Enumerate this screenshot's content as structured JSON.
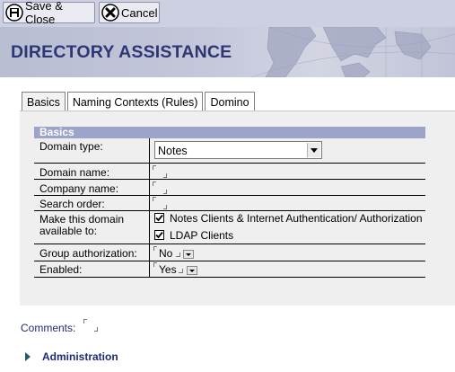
{
  "toolbar": {
    "save_label": "Save & Close",
    "save_icon": "disk-icon",
    "cancel_label": "Cancel",
    "cancel_icon": "close-circle-icon"
  },
  "banner": {
    "title": "DIRECTORY ASSISTANCE"
  },
  "tabs": [
    {
      "label": "Basics",
      "active": true
    },
    {
      "label": "Naming Contexts (Rules)",
      "active": false
    },
    {
      "label": "Domino",
      "active": false
    }
  ],
  "section": {
    "title": "Basics",
    "fields": {
      "domain_type": {
        "label": "Domain type:",
        "value": "Notes"
      },
      "domain_name": {
        "label": "Domain name:",
        "value": ""
      },
      "company_name": {
        "label": "Company name:",
        "value": ""
      },
      "search_order": {
        "label": "Search order:",
        "value": ""
      },
      "make_available": {
        "label_line1": "Make this domain",
        "label_line2": "available to:",
        "options": [
          {
            "label": "Notes Clients & Internet Authentication/ Authorization",
            "checked": true
          },
          {
            "label": "LDAP Clients",
            "checked": true
          }
        ]
      },
      "group_authorization": {
        "label": "Group authorization:",
        "value": "No"
      },
      "enabled": {
        "label": "Enabled:",
        "value": "Yes"
      }
    }
  },
  "comments": {
    "label": "Comments:",
    "value": ""
  },
  "administration": {
    "label": "Administration",
    "expanded": false
  },
  "colors": {
    "toolbar_bg": "#ccd0e1",
    "banner_title": "#2c3773",
    "section_header": "#9ea3c9",
    "panel_bg": "#efefef",
    "link_text": "#1c2a78"
  }
}
